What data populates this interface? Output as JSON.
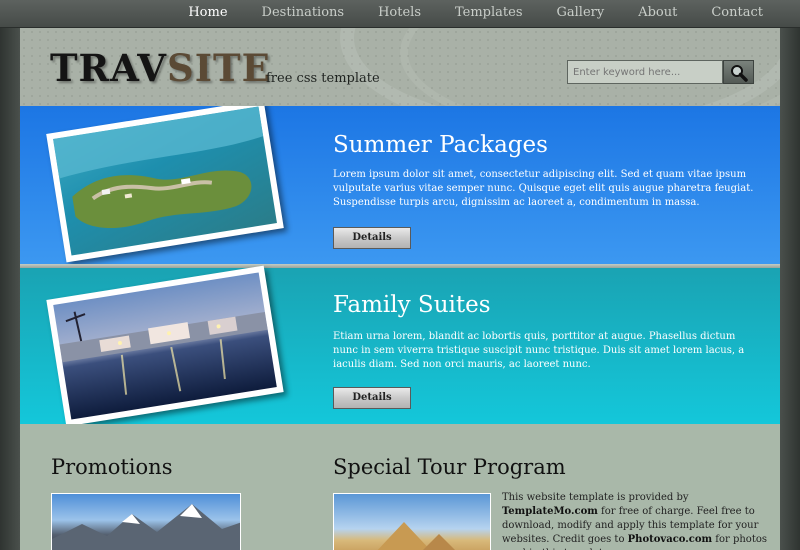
{
  "nav": {
    "items": [
      {
        "label": "Home",
        "active": true
      },
      {
        "label": "Destinations",
        "active": false
      },
      {
        "label": "Hotels",
        "active": false
      },
      {
        "label": "Templates",
        "active": false
      },
      {
        "label": "Gallery",
        "active": false
      },
      {
        "label": "About",
        "active": false
      },
      {
        "label": "Contact",
        "active": false
      }
    ]
  },
  "header": {
    "logo_part1": "TRAV",
    "logo_part2": "SITE",
    "tagline": "free css template",
    "search_placeholder": "Enter keyword here...",
    "search_icon": "magnifier-icon"
  },
  "features": [
    {
      "title": "Summer Packages",
      "text": "Lorem ipsum dolor sit amet, consectetur adipiscing elit. Sed et quam vitae ipsum vulputate varius vitae semper nunc. Quisque eget elit quis augue pharetra feugiat. Suspendisse turpis arcu, dignissim ac laoreet a, condimentum in massa.",
      "button": "Details"
    },
    {
      "title": "Family Suites",
      "text": "Etiam urna lorem, blandit ac lobortis quis, porttitor at augue. Phasellus dictum nunc in sem viverra tristique suscipit nunc tristique. Duis sit amet lorem lacus, a iaculis diam. Sed non orci mauris, ac laoreet nunc.",
      "button": "Details"
    }
  ],
  "promotions": {
    "title": "Promotions"
  },
  "tour": {
    "title": "Special Tour Program",
    "text_1": "This website template is provided by ",
    "link_1": "TemplateMo.com",
    "text_2": " for free of charge. Feel free to download, modify and apply this template for your websites. Credit goes to ",
    "link_2": "Photovaco.com",
    "text_3": " for photos used in this template."
  },
  "colors": {
    "band1": "#1c76e4",
    "band2": "#14c7da",
    "header": "#a9b1a7",
    "content": "#a9b8a9"
  }
}
